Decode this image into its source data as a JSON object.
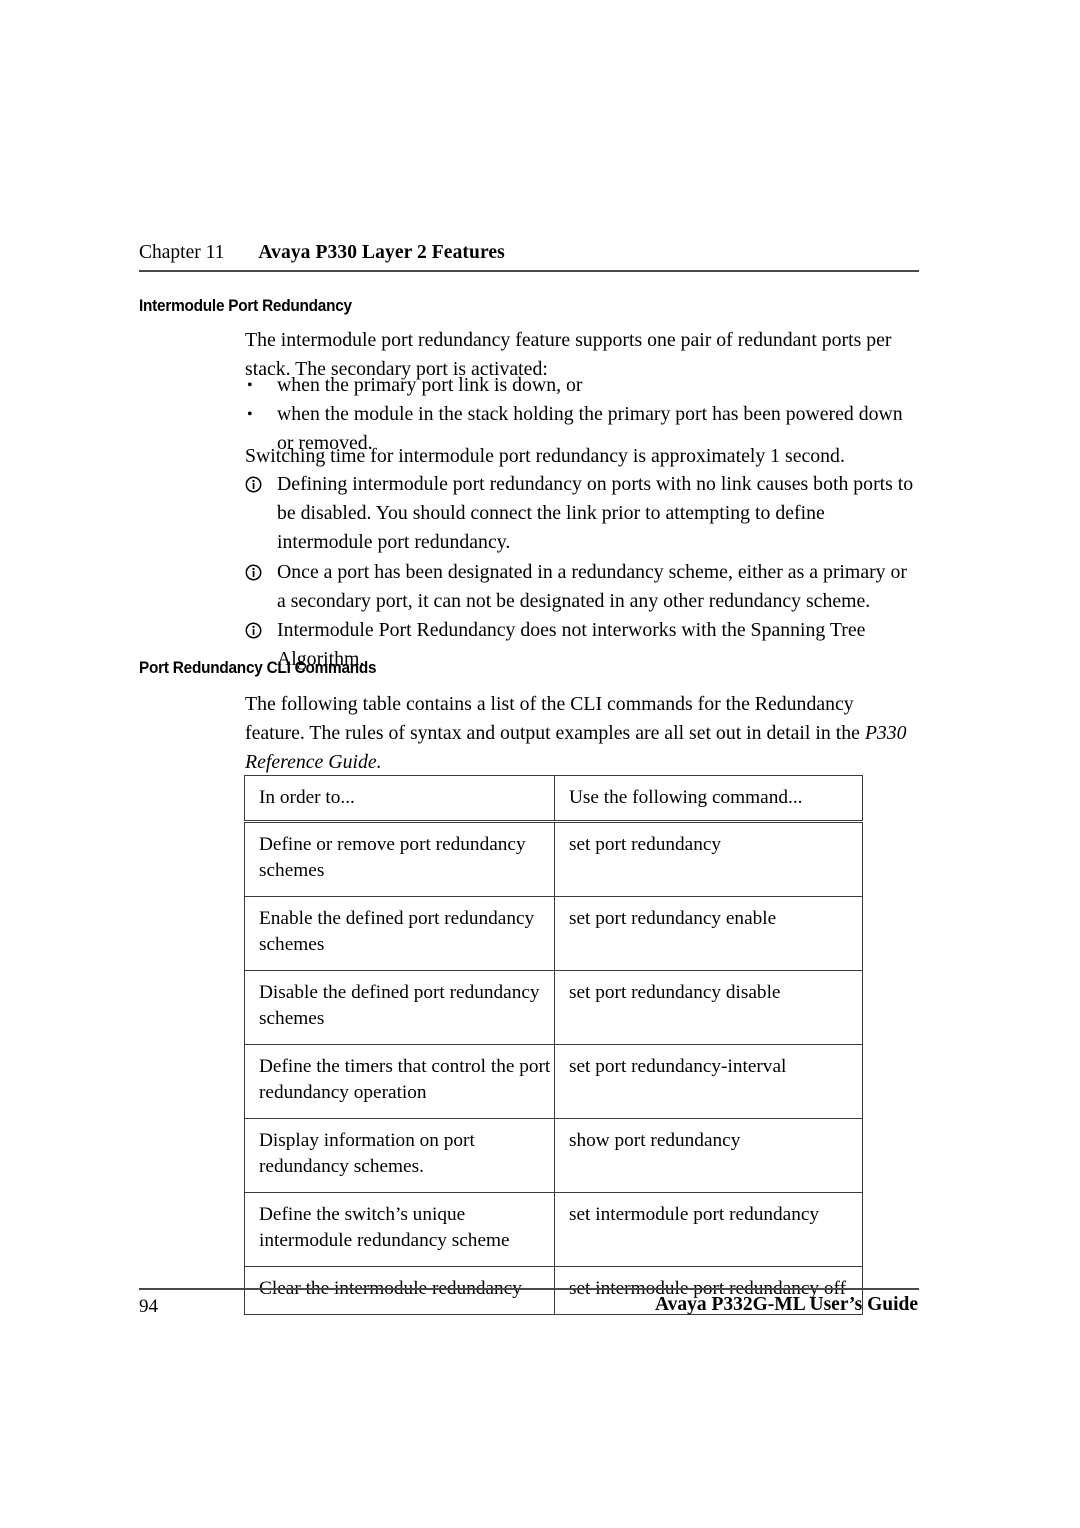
{
  "header": {
    "chapter_number": "Chapter 11",
    "chapter_title": "Avaya P330 Layer 2 Features"
  },
  "sections": {
    "intermodule": {
      "heading": "Intermodule Port Redundancy",
      "intro_paragraph": "The intermodule port redundancy feature supports one pair of redundant ports per stack. The secondary port is activated:",
      "bullets": [
        "when the primary port link is down, or",
        "when the module in the stack holding the primary port has been powered down or removed."
      ],
      "switching_paragraph": "Switching time for intermodule port redundancy is approximately 1 second.",
      "notes": [
        "Defining intermodule port redundancy on ports with no link causes both ports to be disabled. You should connect the link prior to attempting to define intermodule port redundancy.",
        "Once a port has been designated in a redundancy scheme, either as a primary or a secondary port, it can not be designated in any other redundancy scheme.",
        "Intermodule Port Redundancy does not interworks with the Spanning Tree Algorithm."
      ]
    },
    "cli": {
      "heading": "Port Redundancy CLI Commands",
      "intro_text_part1": "The following table contains a list of the CLI commands for the Redundancy feature. The rules of syntax and output examples are all set out in detail in the ",
      "intro_text_italic": "P330 Reference Guide",
      "intro_text_part2": "."
    }
  },
  "table": {
    "columns": [
      "In order to...",
      "Use the following command..."
    ],
    "rows": [
      {
        "task": "Define or remove port redundancy schemes",
        "command": "set port redundancy"
      },
      {
        "task": "Enable the defined port redundancy schemes",
        "command": "set port redundancy enable"
      },
      {
        "task": "Disable the defined port redundancy schemes",
        "command": "set port redundancy disable"
      },
      {
        "task": "Define the timers that control the port redundancy operation",
        "command": "set port redundancy-interval"
      },
      {
        "task": "Display information on port redundancy schemes.",
        "command": "show port redundancy"
      },
      {
        "task": "Define the switch’s unique intermodule redundancy scheme",
        "command": "set intermodule port redundancy"
      },
      {
        "task": "Clear the intermodule redundancy",
        "command": "set intermodule port redundancy off"
      }
    ]
  },
  "footer": {
    "page_number": "94",
    "document_title": "Avaya P332G-ML User’s Guide"
  },
  "icons": {
    "note_marker": "circled-information-icon",
    "bullet_marker": "bullet-dot-icon"
  },
  "colors": {
    "text": "#000000",
    "rule": "#4a4a4a",
    "table_border": "#3c3c3c",
    "page_background": "#ffffff"
  }
}
